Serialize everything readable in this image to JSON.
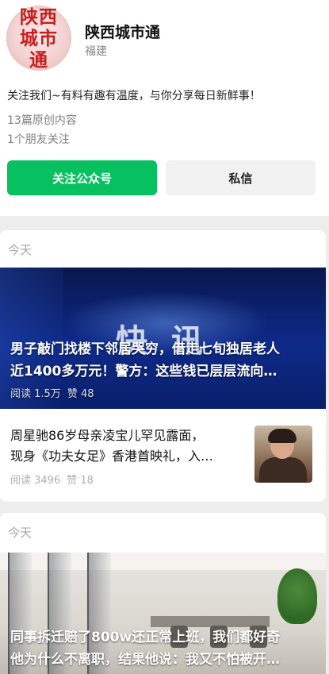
{
  "account": {
    "avatar_text": "陕西城市通",
    "name": "陕西城市通",
    "region": "福建",
    "bio": "关注我们~有料有趣有温度，与你分享每日新鲜事！",
    "original_count": "13篇原创内容",
    "friends_following": "1个朋友关注"
  },
  "actions": {
    "follow_label": "关注公众号",
    "message_label": "私信",
    "accent_color": "#07c160"
  },
  "feed": [
    {
      "date_label": "今天",
      "lead": {
        "banner_text": "快讯",
        "title_line1": "男子敲门找楼下邻居哭穷，借走七旬独居老人",
        "title_line2": "近1400多万元！警方：这些钱已层层流向…",
        "reads": "阅读 1.5万",
        "likes": "赞 48"
      },
      "item": {
        "title_line1": "周星驰86岁母亲凌宝儿罕见露面，",
        "title_line2": "现身《功夫女足》香港首映礼，入…",
        "reads": "阅读 3496",
        "likes": "赞 18",
        "thumb_icon": "portrait-photo"
      }
    },
    {
      "date_label": "今天",
      "lead": {
        "title_line1": "同事拆迁赔了800w还正常上班，我们都好奇",
        "title_line2": "他为什么不离职，结果他说：我又不怕被开…"
      }
    }
  ]
}
